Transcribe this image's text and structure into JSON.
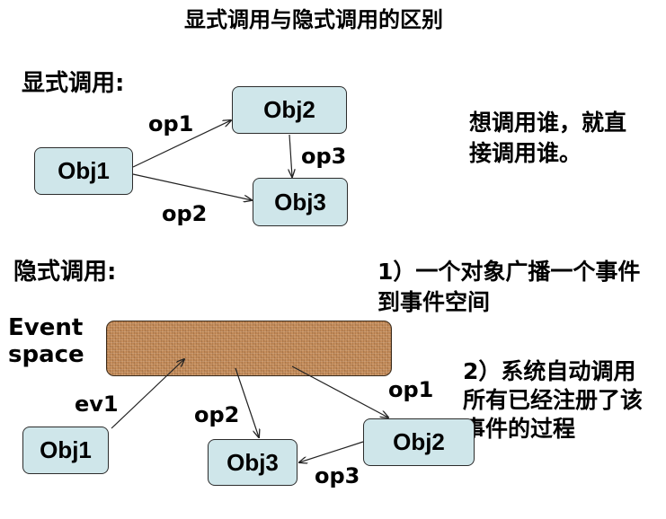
{
  "title": "显式调用与隐式调用的区别",
  "explicit": {
    "heading": "显式调用:",
    "note": "想调用谁，就直接调用谁。",
    "nodes": {
      "obj1": "Obj1",
      "obj2": "Obj2",
      "obj3": "Obj3"
    },
    "edges": {
      "op1": "op1",
      "op2": "op2",
      "op3": "op3"
    }
  },
  "implicit": {
    "heading": "隐式调用:",
    "event_space": "Event space",
    "note1": "1）一个对象广播一个事件到事件空间",
    "note2": "2）系统自动调用所有已经注册了该事件的过程",
    "nodes": {
      "obj1": "Obj1",
      "obj2": "Obj2",
      "obj3": "Obj3"
    },
    "edges": {
      "ev1": "ev1",
      "op1": "op1",
      "op2": "op2",
      "op3": "op3"
    }
  }
}
